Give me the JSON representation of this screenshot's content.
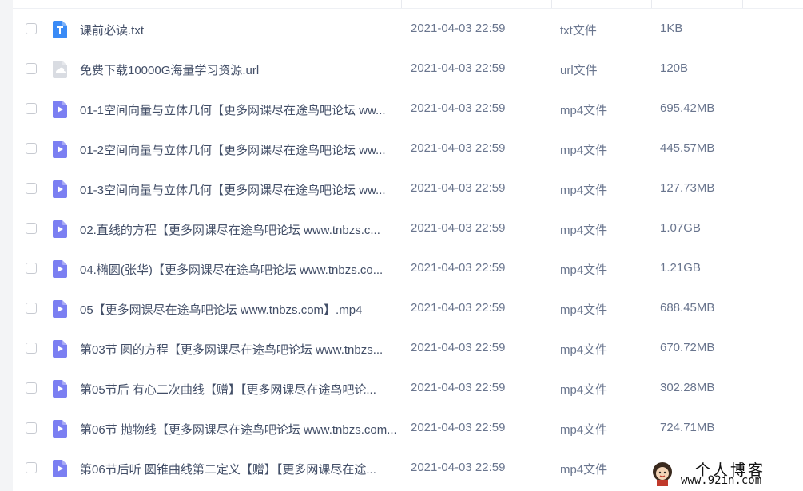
{
  "colors": {
    "txt_icon": "#3a8bf6",
    "url_icon": "#d9dce2",
    "video_icon": "#7b7ff2"
  },
  "files": [
    {
      "icon": "txt-file-icon",
      "name": "课前必读.txt",
      "date": "2021-04-03 22:59",
      "type": "txt文件",
      "size": "1KB"
    },
    {
      "icon": "url-file-icon",
      "name": "免费下载10000G海量学习资源.url",
      "date": "2021-04-03 22:59",
      "type": "url文件",
      "size": "120B"
    },
    {
      "icon": "video-file-icon",
      "name": "01-1空间向量与立体几何【更多网课尽在途鸟吧论坛 ww...",
      "date": "2021-04-03 22:59",
      "type": "mp4文件",
      "size": "695.42MB"
    },
    {
      "icon": "video-file-icon",
      "name": "01-2空间向量与立体几何【更多网课尽在途鸟吧论坛 ww...",
      "date": "2021-04-03 22:59",
      "type": "mp4文件",
      "size": "445.57MB"
    },
    {
      "icon": "video-file-icon",
      "name": "01-3空间向量与立体几何【更多网课尽在途鸟吧论坛 ww...",
      "date": "2021-04-03 22:59",
      "type": "mp4文件",
      "size": "127.73MB"
    },
    {
      "icon": "video-file-icon",
      "name": "02.直线的方程【更多网课尽在途鸟吧论坛 www.tnbzs.c...",
      "date": "2021-04-03 22:59",
      "type": "mp4文件",
      "size": "1.07GB"
    },
    {
      "icon": "video-file-icon",
      "name": "04.椭圆(张华)【更多网课尽在途鸟吧论坛 www.tnbzs.co...",
      "date": "2021-04-03 22:59",
      "type": "mp4文件",
      "size": "1.21GB"
    },
    {
      "icon": "video-file-icon",
      "name": "05【更多网课尽在途鸟吧论坛 www.tnbzs.com】.mp4",
      "date": "2021-04-03 22:59",
      "type": "mp4文件",
      "size": "688.45MB"
    },
    {
      "icon": "video-file-icon",
      "name": "第03节 圆的方程【更多网课尽在途鸟吧论坛 www.tnbzs...",
      "date": "2021-04-03 22:59",
      "type": "mp4文件",
      "size": "670.72MB"
    },
    {
      "icon": "video-file-icon",
      "name": "第05节后 有心二次曲线【赠】【更多网课尽在途鸟吧论...",
      "date": "2021-04-03 22:59",
      "type": "mp4文件",
      "size": "302.28MB"
    },
    {
      "icon": "video-file-icon",
      "name": "第06节 抛物线【更多网课尽在途鸟吧论坛 www.tnbzs.com...",
      "date": "2021-04-03 22:59",
      "type": "mp4文件",
      "size": "724.71MB"
    },
    {
      "icon": "video-file-icon",
      "name": "第06节后听 圆锥曲线第二定义【赠】【更多网课尽在途...",
      "date": "2021-04-03 22:59",
      "type": "mp4文件",
      "size": ""
    }
  ],
  "watermark": {
    "title": "个人博客",
    "url": "www.92in.com"
  }
}
